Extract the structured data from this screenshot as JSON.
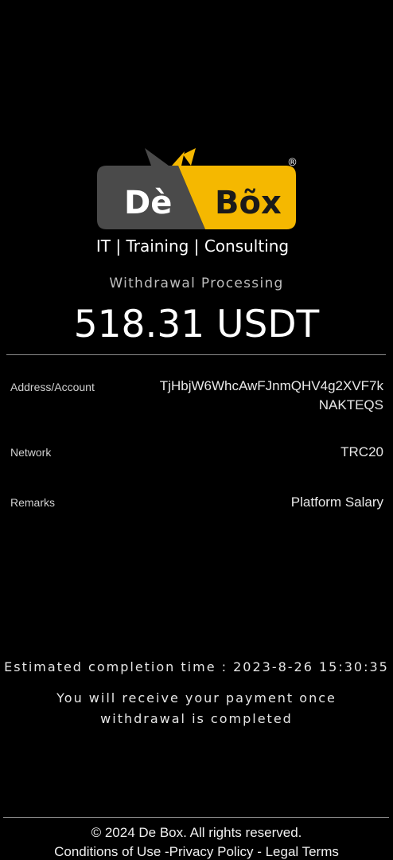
{
  "logo": {
    "brand_left": "Dè",
    "brand_right": "Bõx",
    "registered": "®",
    "tagline": "IT | Training | Consulting",
    "colors": {
      "left_panel": "#4a4a4a",
      "right_panel": "#f5b800",
      "text_light": "#ffffff",
      "text_dark": "#1a1a1a"
    }
  },
  "status": {
    "label": "Withdrawal Processing",
    "amount": "518.31 USDT"
  },
  "details": [
    {
      "label": "Address/Account",
      "value": "TjHbjW6WhcAwFJnmQHV4g2XVF7kNAKTEQS"
    },
    {
      "label": "Network",
      "value": "TRC20"
    },
    {
      "label": "Remarks",
      "value": "Platform Salary"
    }
  ],
  "estimate": {
    "text": "Estimated completion time : 2023-8-26 15:30:35"
  },
  "notice": {
    "text": "You will receive your payment once withdrawal is completed"
  },
  "footer": {
    "copyright": "© 2024 De Box. All rights reserved.",
    "conditions": "Conditions of Use",
    "sep1": " -",
    "privacy": "Privacy Policy",
    "sep2": " - ",
    "legal": "Legal Terms"
  }
}
